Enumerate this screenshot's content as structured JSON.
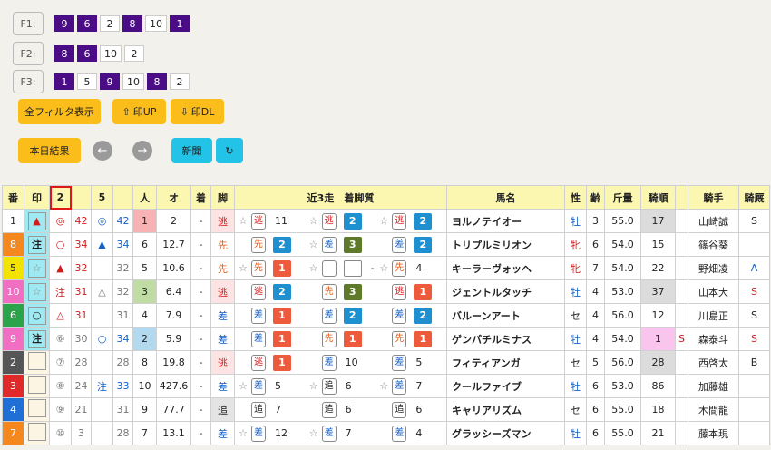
{
  "filters": [
    {
      "label": "F1:",
      "chips": [
        {
          "t": "9",
          "p": true
        },
        {
          "t": "6",
          "p": true
        },
        {
          "t": "2",
          "p": false
        },
        {
          "t": "8",
          "p": true
        },
        {
          "t": "10",
          "p": false
        },
        {
          "t": "1",
          "p": true
        }
      ]
    },
    {
      "label": "F2:",
      "chips": [
        {
          "t": "8",
          "p": true
        },
        {
          "t": "6",
          "p": true
        },
        {
          "t": "10",
          "p": false
        },
        {
          "t": "2",
          "p": false
        }
      ]
    },
    {
      "label": "F3:",
      "chips": [
        {
          "t": "1",
          "p": true
        },
        {
          "t": "5",
          "p": false
        },
        {
          "t": "9",
          "p": true
        },
        {
          "t": "10",
          "p": false
        },
        {
          "t": "8",
          "p": true
        },
        {
          "t": "2",
          "p": false
        }
      ]
    }
  ],
  "buttons": {
    "all_filter": "全フィルタ表示",
    "mark_up": "印UP",
    "mark_dl": "印DL",
    "today_results": "本日結果",
    "prev": "←",
    "next": "→",
    "newspaper": "新聞",
    "refresh": "↻"
  },
  "headers": [
    "番",
    "印",
    "2",
    "",
    "5",
    "",
    "人",
    "オ",
    "着",
    "脚",
    "近3走　着脚質",
    "馬名",
    "性",
    "齢",
    "斤量",
    "騎順",
    "",
    "騎手",
    "騎厩"
  ],
  "colors": {
    "accent_yellow": "#fbbd1a",
    "accent_cyan": "#22c3e6",
    "chip_purple": "#4b0d86"
  },
  "rows": [
    {
      "no": "1",
      "nobg": "#ffffff",
      "nocol": "#222",
      "mark": "▲",
      "markc": "#d21b1b",
      "mbg": "#9ee9f2",
      "s2": "◎",
      "s2c": "#d21b1b",
      "v2": "42",
      "v2c": "#d21b1b",
      "s5": "◎",
      "s5c": "#1560c7",
      "v5": "42",
      "v5c": "#1560c7",
      "pop": "1",
      "popbg": "#f7b3b3",
      "odds": "2",
      "fin": "-",
      "leg": "逃",
      "legc": "#d21b1b",
      "legbg": "#fde3e3",
      "r": [
        {
          "star": "☆",
          "b": "逃",
          "bc": "#d21b1b",
          "x": "11"
        },
        {
          "star": "☆",
          "b": "逃",
          "bc": "#d21b1b",
          "sq": "2",
          "sqc": "#1e8fcf"
        },
        {
          "star": "☆",
          "b": "逃",
          "bc": "#d21b1b",
          "sq": "2",
          "sqc": "#1e8fcf"
        }
      ],
      "name": "ヨルノテイオー",
      "sex": "牡",
      "sexc": "#1560c7",
      "age": "3",
      "wt": "55.0",
      "jr": "17",
      "jrbg": "#dcdcdc",
      "jm": "",
      "jockey": "山崎誠",
      "st": "S",
      "stc": "#222"
    },
    {
      "no": "8",
      "nobg": "#f4881f",
      "nocol": "#fff",
      "mark": "注",
      "markc": "#222",
      "mbg": "#9ee9f2",
      "s2": "○",
      "s2c": "#d21b1b",
      "v2": "34",
      "v2c": "#d21b1b",
      "s5": "▲",
      "s5c": "#1560c7",
      "v5": "34",
      "v5c": "#1560c7",
      "pop": "6",
      "popbg": "",
      "odds": "12.7",
      "fin": "-",
      "leg": "先",
      "legc": "#e05a16",
      "legbg": "",
      "r": [
        {
          "star": "",
          "b": "先",
          "bc": "#e05a16",
          "sq": "2",
          "sqc": "#1e8fcf"
        },
        {
          "star": "☆",
          "b": "差",
          "bc": "#1560c7",
          "sq": "3",
          "sqc": "#5f7a2a"
        },
        {
          "star": "",
          "b": "差",
          "bc": "#1560c7",
          "sq": "2",
          "sqc": "#1e8fcf"
        }
      ],
      "name": "トリプルミリオン",
      "sex": "牝",
      "sexc": "#d21b1b",
      "age": "6",
      "wt": "54.0",
      "jr": "15",
      "jrbg": "",
      "jm": "",
      "jockey": "篠谷葵",
      "st": "",
      "stc": "#222"
    },
    {
      "no": "5",
      "nobg": "#f2e400",
      "nocol": "#222",
      "mark": "☆",
      "markc": "#888",
      "mbg": "#9ee9f2",
      "s2": "▲",
      "s2c": "#d21b1b",
      "v2": "32",
      "v2c": "#d21b1b",
      "s5": "",
      "s5c": "#222",
      "v5": "32",
      "v5c": "#777",
      "pop": "5",
      "popbg": "",
      "odds": "10.6",
      "fin": "-",
      "leg": "先",
      "legc": "#e05a16",
      "legbg": "",
      "r": [
        {
          "star": "☆",
          "b": "先",
          "bc": "#e05a16",
          "sq": "1",
          "sqc": "#ee5a3c"
        },
        {
          "star": "☆",
          "b": "",
          "bc": "#222",
          "sq": " ",
          "sqc": "#fff",
          "x": "-"
        },
        {
          "star": "☆",
          "b": "先",
          "bc": "#e05a16",
          "x": "4"
        }
      ],
      "name": "キーラーヴォッヘ",
      "sex": "牝",
      "sexc": "#d21b1b",
      "age": "7",
      "wt": "54.0",
      "jr": "22",
      "jrbg": "",
      "jm": "",
      "jockey": "野畑凌",
      "st": "A",
      "stc": "#1560c7"
    },
    {
      "no": "10",
      "nobg": "#f06fc2",
      "nocol": "#fff",
      "mark": "☆",
      "markc": "#888",
      "mbg": "#9ee9f2",
      "s2": "注",
      "s2c": "#d21b1b",
      "v2": "31",
      "v2c": "#d21b1b",
      "s5": "△",
      "s5c": "#777",
      "v5": "32",
      "v5c": "#777",
      "pop": "3",
      "popbg": "#bfdca5",
      "odds": "6.4",
      "fin": "-",
      "leg": "逃",
      "legc": "#d21b1b",
      "legbg": "#fde3e3",
      "r": [
        {
          "star": "",
          "b": "逃",
          "bc": "#d21b1b",
          "sq": "2",
          "sqc": "#1e8fcf"
        },
        {
          "star": "",
          "b": "先",
          "bc": "#e05a16",
          "sq": "3",
          "sqc": "#5f7a2a"
        },
        {
          "star": "",
          "b": "逃",
          "bc": "#d21b1b",
          "sq": "1",
          "sqc": "#ee5a3c"
        }
      ],
      "name": "ジェントルタッチ",
      "sex": "牡",
      "sexc": "#1560c7",
      "age": "4",
      "wt": "53.0",
      "jr": "37",
      "jrbg": "#dcdcdc",
      "jm": "",
      "jockey": "山本大",
      "st": "S",
      "stc": "#d21b1b"
    },
    {
      "no": "6",
      "nobg": "#2aa44a",
      "nocol": "#fff",
      "mark": "○",
      "markc": "#222",
      "mbg": "#9ee9f2",
      "s2": "△",
      "s2c": "#d21b1b",
      "v2": "31",
      "v2c": "#d21b1b",
      "s5": "",
      "s5c": "#222",
      "v5": "31",
      "v5c": "#777",
      "pop": "4",
      "popbg": "",
      "odds": "7.9",
      "fin": "-",
      "leg": "差",
      "legc": "#1560c7",
      "legbg": "",
      "r": [
        {
          "star": "",
          "b": "差",
          "bc": "#1560c7",
          "sq": "1",
          "sqc": "#ee5a3c"
        },
        {
          "star": "",
          "b": "差",
          "bc": "#1560c7",
          "sq": "2",
          "sqc": "#1e8fcf"
        },
        {
          "star": "",
          "b": "差",
          "bc": "#1560c7",
          "sq": "2",
          "sqc": "#1e8fcf"
        }
      ],
      "name": "バルーンアート",
      "sex": "セ",
      "sexc": "#222",
      "age": "4",
      "wt": "56.0",
      "jr": "12",
      "jrbg": "",
      "jm": "",
      "jockey": "川島正",
      "st": "S",
      "stc": "#222"
    },
    {
      "no": "9",
      "nobg": "#f06fc2",
      "nocol": "#fff",
      "mark": "注",
      "markc": "#222",
      "mbg": "#9ee9f2",
      "s2": "⑥",
      "s2c": "#777",
      "v2": "30",
      "v2c": "#777",
      "s5": "○",
      "s5c": "#1560c7",
      "v5": "34",
      "v5c": "#1560c7",
      "pop": "2",
      "popbg": "#b3d9ef",
      "odds": "5.9",
      "fin": "-",
      "leg": "差",
      "legc": "#1560c7",
      "legbg": "",
      "r": [
        {
          "star": "",
          "b": "差",
          "bc": "#1560c7",
          "sq": "1",
          "sqc": "#ee5a3c"
        },
        {
          "star": "",
          "b": "先",
          "bc": "#e05a16",
          "sq": "1",
          "sqc": "#ee5a3c"
        },
        {
          "star": "",
          "b": "先",
          "bc": "#e05a16",
          "sq": "1",
          "sqc": "#ee5a3c"
        }
      ],
      "name": "ゲンパチルミナス",
      "sex": "牡",
      "sexc": "#1560c7",
      "age": "4",
      "wt": "54.0",
      "jr": "1",
      "jrbg": "#f9c5ef",
      "jm": "S",
      "jockey": "森泰斗",
      "st": "S",
      "stc": "#d21b1b"
    },
    {
      "no": "2",
      "nobg": "#555555",
      "nocol": "#fff",
      "mark": "",
      "markc": "#222",
      "mbg": "#fdf5e3",
      "s2": "⑦",
      "s2c": "#777",
      "v2": "28",
      "v2c": "#777",
      "s5": "",
      "s5c": "#222",
      "v5": "28",
      "v5c": "#777",
      "pop": "8",
      "popbg": "",
      "odds": "19.8",
      "fin": "-",
      "leg": "逃",
      "legc": "#d21b1b",
      "legbg": "#fde3e3",
      "r": [
        {
          "star": "",
          "b": "逃",
          "bc": "#d21b1b",
          "sq": "1",
          "sqc": "#ee5a3c"
        },
        {
          "star": "",
          "b": "差",
          "bc": "#1560c7",
          "x": "10"
        },
        {
          "star": "",
          "b": "差",
          "bc": "#1560c7",
          "x": "5"
        }
      ],
      "name": "フィティアンガ",
      "sex": "セ",
      "sexc": "#222",
      "age": "5",
      "wt": "56.0",
      "jr": "28",
      "jrbg": "#dcdcdc",
      "jm": "",
      "jockey": "西啓太",
      "st": "B",
      "stc": "#222"
    },
    {
      "no": "3",
      "nobg": "#e02a2a",
      "nocol": "#fff",
      "mark": "",
      "markc": "#222",
      "mbg": "#fdf5e3",
      "s2": "⑧",
      "s2c": "#777",
      "v2": "24",
      "v2c": "#777",
      "s5": "注",
      "s5c": "#1560c7",
      "v5": "33",
      "v5c": "#1560c7",
      "pop": "10",
      "popbg": "",
      "odds": "427.6",
      "fin": "-",
      "leg": "差",
      "legc": "#1560c7",
      "legbg": "",
      "r": [
        {
          "star": "☆",
          "b": "差",
          "bc": "#1560c7",
          "x": "5"
        },
        {
          "star": "☆",
          "b": "追",
          "bc": "#222",
          "x": "6"
        },
        {
          "star": "☆",
          "b": "差",
          "bc": "#1560c7",
          "x": "7"
        }
      ],
      "name": "クールファイブ",
      "sex": "牡",
      "sexc": "#1560c7",
      "age": "6",
      "wt": "53.0",
      "jr": "86",
      "jrbg": "",
      "jm": "",
      "jockey": "加藤雄",
      "st": "",
      "stc": "#222"
    },
    {
      "no": "4",
      "nobg": "#1f6fd6",
      "nocol": "#fff",
      "mark": "",
      "markc": "#222",
      "mbg": "#fdf5e3",
      "s2": "⑨",
      "s2c": "#777",
      "v2": "21",
      "v2c": "#777",
      "s5": "",
      "s5c": "#222",
      "v5": "31",
      "v5c": "#777",
      "pop": "9",
      "popbg": "",
      "odds": "77.7",
      "fin": "-",
      "leg": "追",
      "legc": "#222",
      "legbg": "#e4e4e4",
      "r": [
        {
          "star": "",
          "b": "追",
          "bc": "#222",
          "x": "7"
        },
        {
          "star": "",
          "b": "追",
          "bc": "#222",
          "x": "6"
        },
        {
          "star": "",
          "b": "追",
          "bc": "#222",
          "x": "6"
        }
      ],
      "name": "キャリアリズム",
      "sex": "セ",
      "sexc": "#222",
      "age": "6",
      "wt": "55.0",
      "jr": "18",
      "jrbg": "",
      "jm": "",
      "jockey": "木間龍",
      "st": "",
      "stc": "#222"
    },
    {
      "no": "7",
      "nobg": "#f4881f",
      "nocol": "#fff",
      "mark": "",
      "markc": "#222",
      "mbg": "#fdf5e3",
      "s2": "⑩",
      "s2c": "#777",
      "v2": "3",
      "v2c": "#777",
      "s5": "",
      "s5c": "#222",
      "v5": "28",
      "v5c": "#777",
      "pop": "7",
      "popbg": "",
      "odds": "13.1",
      "fin": "-",
      "leg": "差",
      "legc": "#1560c7",
      "legbg": "",
      "r": [
        {
          "star": "☆",
          "b": "差",
          "bc": "#1560c7",
          "x": "12"
        },
        {
          "star": "☆",
          "b": "差",
          "bc": "#1560c7",
          "x": "7"
        },
        {
          "star": "",
          "b": "差",
          "bc": "#1560c7",
          "x": "4"
        }
      ],
      "name": "グラッシーズマン",
      "sex": "牡",
      "sexc": "#1560c7",
      "age": "6",
      "wt": "55.0",
      "jr": "21",
      "jrbg": "",
      "jm": "",
      "jockey": "藤本現",
      "st": "",
      "stc": "#222"
    }
  ]
}
